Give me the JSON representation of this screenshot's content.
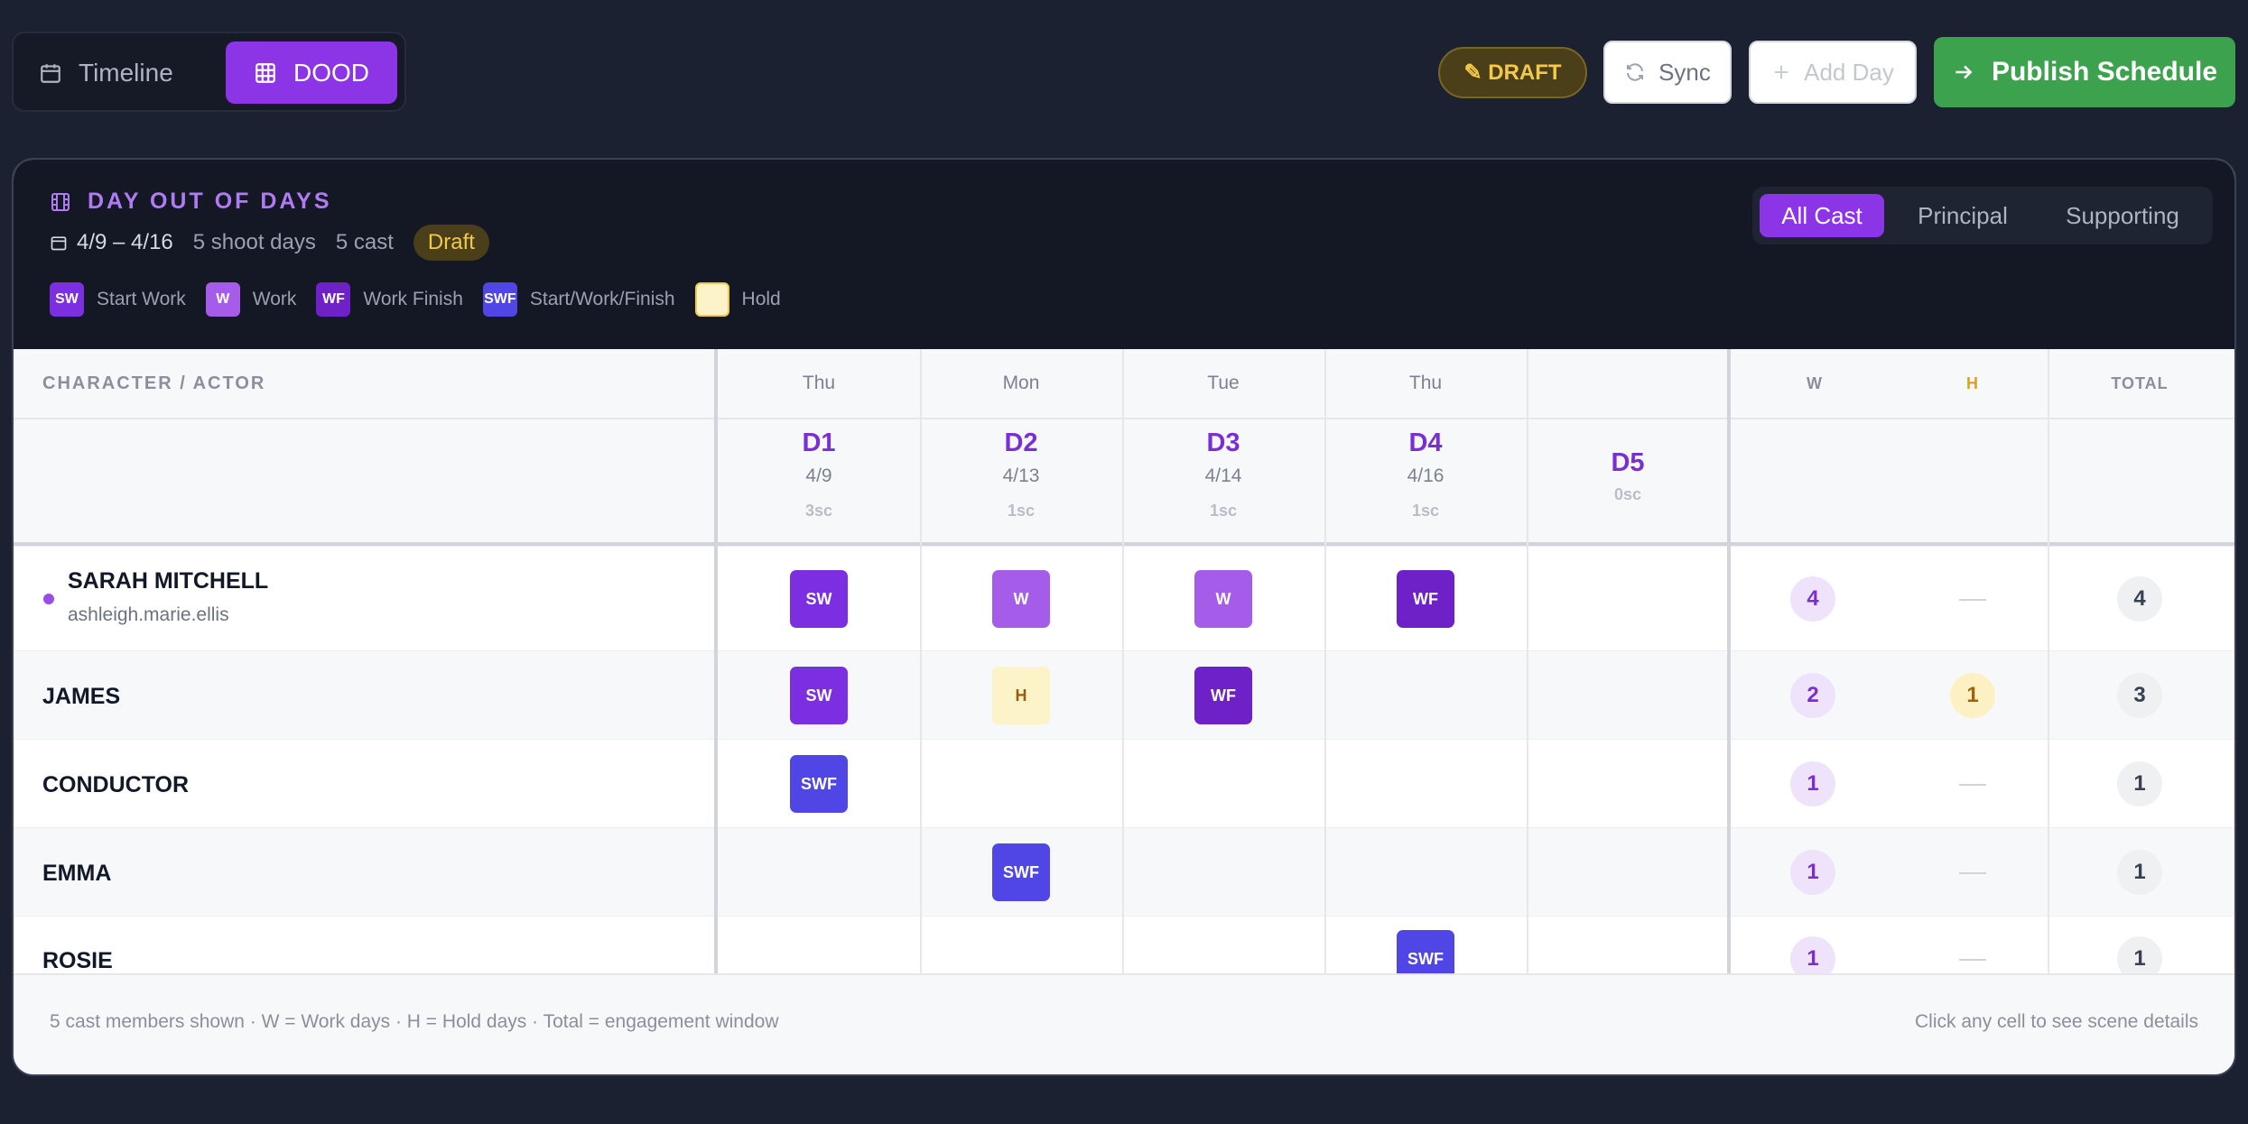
{
  "toolbar": {
    "views": [
      {
        "label": "Timeline",
        "icon": "calendar-icon",
        "active": false
      },
      {
        "label": "DOOD",
        "icon": "grid-icon",
        "active": true
      }
    ],
    "status_pill": "✎ DRAFT",
    "sync_label": "Sync",
    "add_day_label": "Add Day",
    "publish_label": "Publish Schedule",
    "colors": {
      "accent": "#8b35e6",
      "publish": "#3da24e",
      "draft": "#f3c94a"
    }
  },
  "panel": {
    "title": "DAY OUT OF DAYS",
    "range": "4/9 – 4/16",
    "shoot_days": "5 shoot days",
    "cast_count": "5 cast",
    "status_badge": "Draft",
    "legend": [
      {
        "code": "SW",
        "label": "Start Work",
        "color": "#7b2fe0"
      },
      {
        "code": "W",
        "label": "Work",
        "color": "#a55ce8"
      },
      {
        "code": "WF",
        "label": "Work Finish",
        "color": "#6d21c7"
      },
      {
        "code": "SWF",
        "label": "Start/Work/Finish",
        "color": "#4f46e5"
      },
      {
        "code": "H",
        "label": "Hold",
        "color": "#fdf3c8"
      }
    ],
    "filters": [
      {
        "label": "All Cast",
        "active": true
      },
      {
        "label": "Principal",
        "active": false
      },
      {
        "label": "Supporting",
        "active": false
      }
    ]
  },
  "table": {
    "column_header": "CHARACTER / ACTOR",
    "days": [
      {
        "dow": "Thu",
        "code": "D1",
        "date": "4/9",
        "scenes": "3sc"
      },
      {
        "dow": "Mon",
        "code": "D2",
        "date": "4/13",
        "scenes": "1sc"
      },
      {
        "dow": "Tue",
        "code": "D3",
        "date": "4/14",
        "scenes": "1sc"
      },
      {
        "dow": "Thu",
        "code": "D4",
        "date": "4/16",
        "scenes": "1sc"
      },
      {
        "dow": "",
        "code": "D5",
        "date": "",
        "scenes": "0sc"
      }
    ],
    "summary_headers": {
      "w": "W",
      "h": "H",
      "total": "TOTAL"
    },
    "rows": [
      {
        "name": "SARAH MITCHELL",
        "actor": "ashleigh.marie.ellis",
        "cells": [
          "SW",
          "W",
          "W",
          "WF",
          ""
        ],
        "w": "4",
        "h": "",
        "total": "4"
      },
      {
        "name": "JAMES",
        "actor": "",
        "cells": [
          "SW",
          "H",
          "WF",
          "",
          ""
        ],
        "w": "2",
        "h": "1",
        "total": "3"
      },
      {
        "name": "CONDUCTOR",
        "actor": "",
        "cells": [
          "SWF",
          "",
          "",
          "",
          ""
        ],
        "w": "1",
        "h": "",
        "total": "1"
      },
      {
        "name": "EMMA",
        "actor": "",
        "cells": [
          "",
          "SWF",
          "",
          "",
          ""
        ],
        "w": "1",
        "h": "",
        "total": "1"
      },
      {
        "name": "ROSIE",
        "actor": "",
        "cells": [
          "",
          "",
          "",
          "SWF",
          ""
        ],
        "w": "1",
        "h": "",
        "total": "1"
      }
    ]
  },
  "footer": {
    "left": "5 cast members shown · W = Work days · H = Hold days · Total = engagement window",
    "right": "Click any cell to see scene details"
  }
}
